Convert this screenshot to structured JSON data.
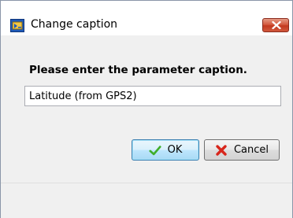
{
  "window": {
    "title": "Change caption",
    "icon": "app-icon",
    "close_icon": "close-icon"
  },
  "dialog": {
    "prompt": "Please enter the parameter caption.",
    "caption_value": "Latitude (from GPS2)"
  },
  "buttons": {
    "ok_label": "OK",
    "ok_icon": "checkmark-icon",
    "cancel_label": "Cancel",
    "cancel_icon": "red-x-icon"
  },
  "colors": {
    "close_button": "#c2391f",
    "ok_check": "#3fae2a",
    "cancel_x": "#d8261b"
  }
}
